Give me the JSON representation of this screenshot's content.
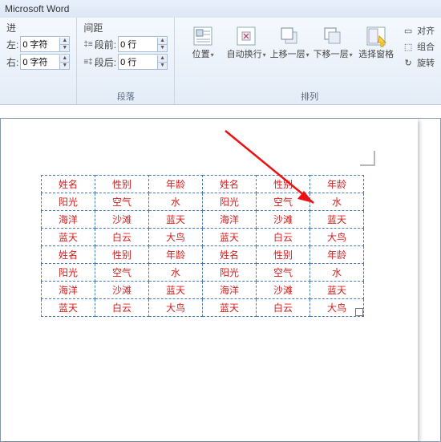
{
  "title": "Microsoft Word",
  "ribbon": {
    "paragraph_group": "段落",
    "arrange_group": "排列",
    "indent_label_left": "左:",
    "indent_label_right": "右:",
    "indent_left": "0 字符",
    "indent_right": "0 字符",
    "indent_header": "进",
    "spacing_header": "间距",
    "spacing_before_lbl": "段前:",
    "spacing_after_lbl": "段后:",
    "spacing_before": "0 行",
    "spacing_after": "0 行",
    "btn_position": "位置",
    "btn_wrap": "自动换行",
    "btn_forward": "上移一层",
    "btn_backward": "下移一层",
    "btn_selection_pane": "选择窗格",
    "cmd_align": "对齐",
    "cmd_group": "组合",
    "cmd_rotate": "旋转"
  },
  "table": {
    "rows": [
      [
        "姓名",
        "性别",
        "年龄",
        "姓名",
        "性别",
        "年龄"
      ],
      [
        "阳光",
        "空气",
        "水",
        "阳光",
        "空气",
        "水"
      ],
      [
        "海洋",
        "沙滩",
        "蓝天",
        "海洋",
        "沙滩",
        "蓝天"
      ],
      [
        "蓝天",
        "白云",
        "大鸟",
        "蓝天",
        "白云",
        "大鸟"
      ],
      [
        "姓名",
        "性别",
        "年龄",
        "姓名",
        "性别",
        "年龄"
      ],
      [
        "阳光",
        "空气",
        "水",
        "阳光",
        "空气",
        "水"
      ],
      [
        "海洋",
        "沙滩",
        "蓝天",
        "海洋",
        "沙滩",
        "蓝天"
      ],
      [
        "蓝天",
        "白云",
        "大鸟",
        "蓝天",
        "白云",
        "大鸟"
      ]
    ]
  }
}
